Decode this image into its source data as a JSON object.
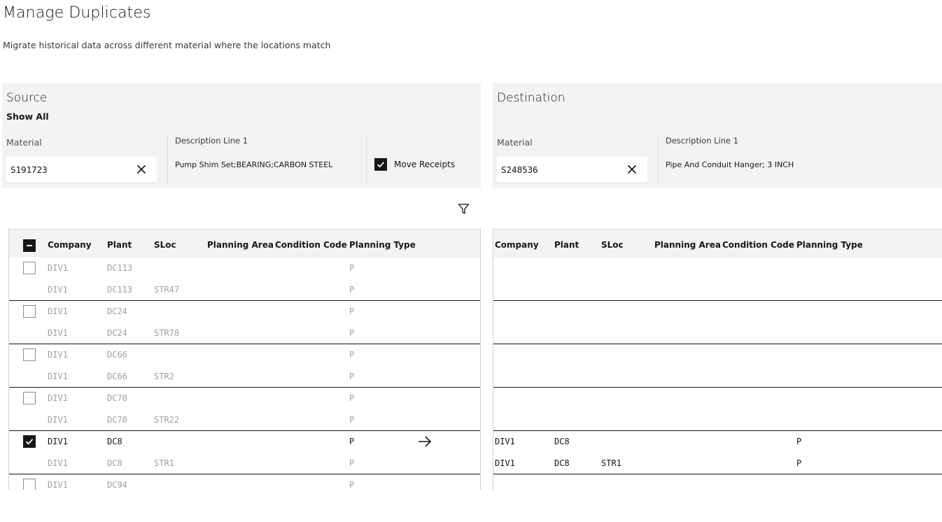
{
  "page": {
    "title": "Manage Duplicates",
    "subtitle": "Migrate historical data across different material where the locations match"
  },
  "source": {
    "title": "Source",
    "show_all": "Show All",
    "material_label": "Material",
    "material_value": "S191723",
    "desc_label": "Description Line 1",
    "desc_value": "Pump Shim Set;BEARING;CARBON STEEL",
    "move_receipts_label": "Move Receipts",
    "move_receipts_checked": true
  },
  "destination": {
    "title": "Destination",
    "material_label": "Material",
    "material_value": "S248536",
    "desc_label": "Description Line 1",
    "desc_value": "Pipe And Conduit Hanger; 3 INCH"
  },
  "columns": [
    "Company",
    "Plant",
    "SLoc",
    "Planning Area",
    "Condition Code",
    "Planning Type"
  ],
  "source_rows": [
    {
      "group": 0,
      "checkbox": "unchecked",
      "active": false,
      "company": "DIV1",
      "plant": "DC113",
      "sloc": "",
      "planning_area": "",
      "condition_code": "",
      "planning_type": "P"
    },
    {
      "group": 0,
      "checkbox": "none",
      "active": false,
      "company": "DIV1",
      "plant": "DC113",
      "sloc": "STR47",
      "planning_area": "",
      "condition_code": "",
      "planning_type": "P"
    },
    {
      "group": 1,
      "checkbox": "unchecked",
      "active": false,
      "company": "DIV1",
      "plant": "DC24",
      "sloc": "",
      "planning_area": "",
      "condition_code": "",
      "planning_type": "P"
    },
    {
      "group": 1,
      "checkbox": "none",
      "active": false,
      "company": "DIV1",
      "plant": "DC24",
      "sloc": "STR78",
      "planning_area": "",
      "condition_code": "",
      "planning_type": "P"
    },
    {
      "group": 2,
      "checkbox": "unchecked",
      "active": false,
      "company": "DIV1",
      "plant": "DC66",
      "sloc": "",
      "planning_area": "",
      "condition_code": "",
      "planning_type": "P"
    },
    {
      "group": 2,
      "checkbox": "none",
      "active": false,
      "company": "DIV1",
      "plant": "DC66",
      "sloc": "STR2",
      "planning_area": "",
      "condition_code": "",
      "planning_type": "P"
    },
    {
      "group": 3,
      "checkbox": "unchecked",
      "active": false,
      "company": "DIV1",
      "plant": "DC70",
      "sloc": "",
      "planning_area": "",
      "condition_code": "",
      "planning_type": "P"
    },
    {
      "group": 3,
      "checkbox": "none",
      "active": false,
      "company": "DIV1",
      "plant": "DC70",
      "sloc": "STR22",
      "planning_area": "",
      "condition_code": "",
      "planning_type": "P"
    },
    {
      "group": 4,
      "checkbox": "checked",
      "active": true,
      "arrow": true,
      "company": "DIV1",
      "plant": "DC8",
      "sloc": "",
      "planning_area": "",
      "condition_code": "",
      "planning_type": "P"
    },
    {
      "group": 4,
      "checkbox": "none",
      "active": false,
      "company": "DIV1",
      "plant": "DC8",
      "sloc": "STR1",
      "planning_area": "",
      "condition_code": "",
      "planning_type": "P"
    },
    {
      "group": 5,
      "checkbox": "unchecked",
      "active": false,
      "company": "DIV1",
      "plant": "DC94",
      "sloc": "",
      "planning_area": "",
      "condition_code": "",
      "planning_type": "P"
    }
  ],
  "destination_rows": [
    {
      "group": 0,
      "active": false,
      "company": "",
      "plant": "",
      "sloc": "",
      "planning_area": "",
      "condition_code": "",
      "planning_type": ""
    },
    {
      "group": 0,
      "active": false,
      "company": "",
      "plant": "",
      "sloc": "",
      "planning_area": "",
      "condition_code": "",
      "planning_type": ""
    },
    {
      "group": 1,
      "active": false,
      "company": "",
      "plant": "",
      "sloc": "",
      "planning_area": "",
      "condition_code": "",
      "planning_type": ""
    },
    {
      "group": 1,
      "active": false,
      "company": "",
      "plant": "",
      "sloc": "",
      "planning_area": "",
      "condition_code": "",
      "planning_type": ""
    },
    {
      "group": 2,
      "active": false,
      "company": "",
      "plant": "",
      "sloc": "",
      "planning_area": "",
      "condition_code": "",
      "planning_type": ""
    },
    {
      "group": 2,
      "active": false,
      "company": "",
      "plant": "",
      "sloc": "",
      "planning_area": "",
      "condition_code": "",
      "planning_type": ""
    },
    {
      "group": 3,
      "active": false,
      "company": "",
      "plant": "",
      "sloc": "",
      "planning_area": "",
      "condition_code": "",
      "planning_type": ""
    },
    {
      "group": 3,
      "active": false,
      "company": "",
      "plant": "",
      "sloc": "",
      "planning_area": "",
      "condition_code": "",
      "planning_type": ""
    },
    {
      "group": 4,
      "active": true,
      "company": "DIV1",
      "plant": "DC8",
      "sloc": "",
      "planning_area": "",
      "condition_code": "",
      "planning_type": "P"
    },
    {
      "group": 4,
      "active": true,
      "company": "DIV1",
      "plant": "DC8",
      "sloc": "STR1",
      "planning_area": "",
      "condition_code": "",
      "planning_type": "P"
    },
    {
      "group": 5,
      "active": false,
      "company": "",
      "plant": "",
      "sloc": "",
      "planning_area": "",
      "condition_code": "",
      "planning_type": ""
    }
  ],
  "icons": {
    "clear": "close-icon",
    "filter": "filter-icon",
    "arrow": "arrow-right-icon",
    "checkmark": "checkmark-icon",
    "indeterminate": "minus-icon"
  },
  "colors": {
    "panel_bg": "#f3f3f3",
    "text_primary": "#161616",
    "text_muted": "#a0a0a0",
    "group_divider": "#161616"
  }
}
